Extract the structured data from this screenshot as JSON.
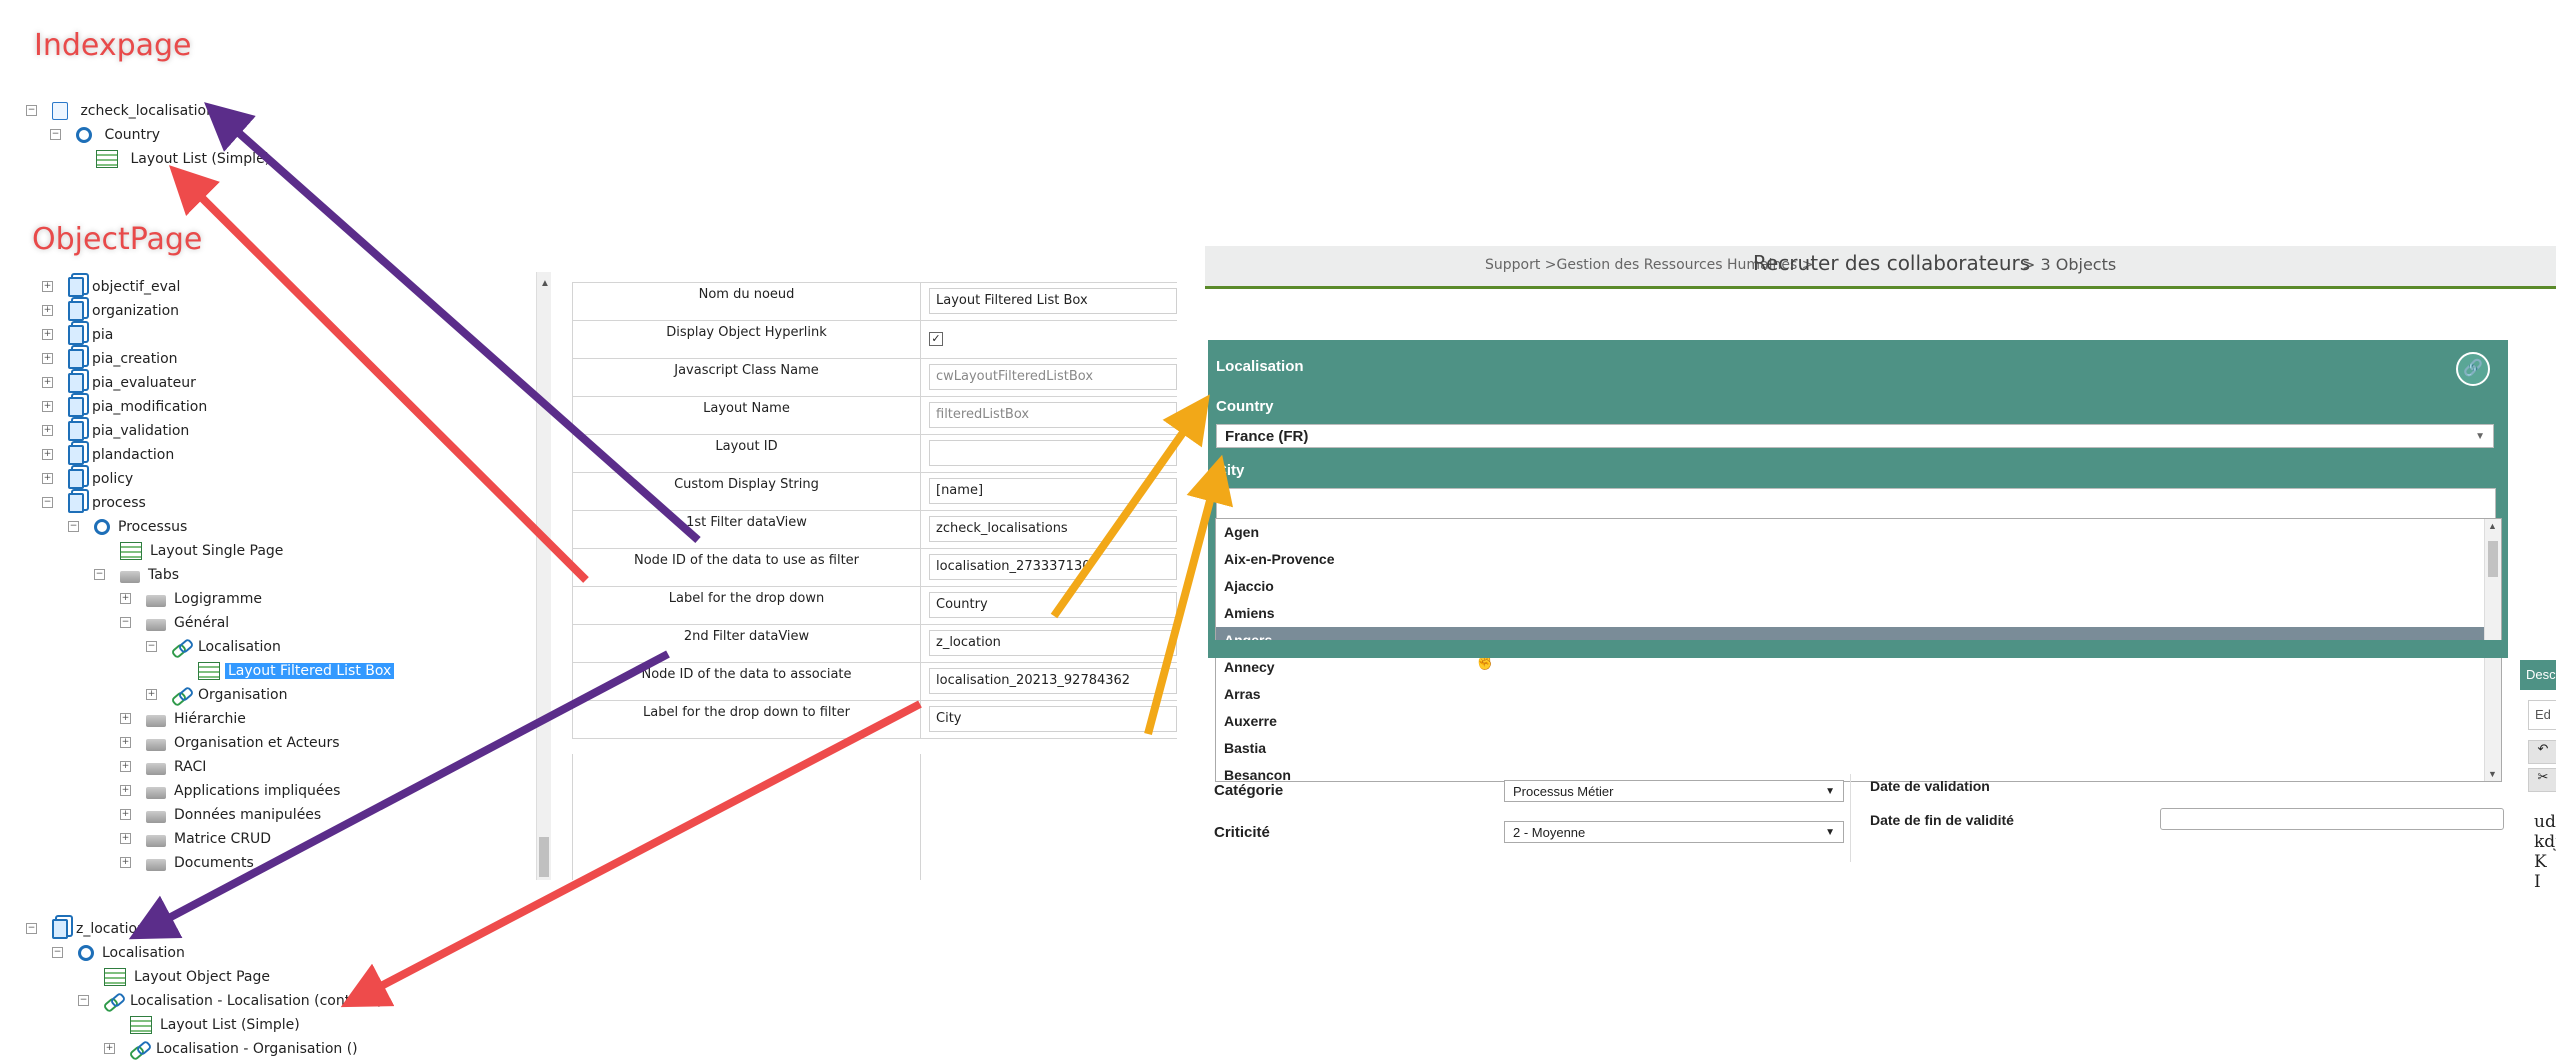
{
  "callouts": {
    "indexpage": "Indexpage",
    "objectpage": "ObjectPage"
  },
  "index_tree": [
    {
      "label": "zcheck_localisations"
    },
    {
      "label": "Country"
    },
    {
      "label": "Layout List (Simple)"
    }
  ],
  "object_tree": [
    "objectif_eval",
    "organization",
    "pia",
    "pia_creation",
    "pia_evaluateur",
    "pia_modification",
    "pia_validation",
    "plandaction",
    "policy",
    "process",
    "Processus",
    "Layout Single Page",
    "Tabs",
    "Logigramme",
    "Général",
    "Localisation",
    "Layout Filtered List Box",
    "Organisation",
    "Hiérarchie",
    "Organisation et Acteurs",
    "RACI",
    "Applications impliquées",
    "Données manipulées",
    "Matrice CRUD",
    "Documents"
  ],
  "location_tree": [
    "z_location",
    "Localisation",
    "Layout Object Page",
    "Localisation - Localisation (contient)",
    "Layout List (Simple)",
    "Localisation - Organisation ()"
  ],
  "properties": [
    {
      "key": "Nom du noeud",
      "value": "Layout Filtered List Box",
      "type": "text"
    },
    {
      "key": "Display Object Hyperlink",
      "value": "✓",
      "type": "checkbox"
    },
    {
      "key": "Javascript Class Name",
      "value": "cwLayoutFilteredListBox",
      "type": "readonly"
    },
    {
      "key": "Layout Name",
      "value": "filteredListBox",
      "type": "readonly"
    },
    {
      "key": "Layout ID",
      "value": "",
      "type": "text"
    },
    {
      "key": "Custom Display String",
      "value": "[name]",
      "type": "text"
    },
    {
      "key": "1st Filter dataView",
      "value": "zcheck_localisations",
      "type": "text"
    },
    {
      "key": "Node ID of the data to use as filter",
      "value": "localisation_273337130",
      "type": "text"
    },
    {
      "key": "Label for the drop down",
      "value": "Country",
      "type": "text"
    },
    {
      "key": "2nd Filter dataView",
      "value": "z_location",
      "type": "text"
    },
    {
      "key": "Node ID of the data to associate",
      "value": "localisation_20213_92784362",
      "type": "text"
    },
    {
      "key": "Label for the drop down to filter",
      "value": "City",
      "type": "text"
    }
  ],
  "breadcrumb": {
    "prefix": "Support >Gestion des Ressources Humaines >",
    "title": "Recruter des collaborateurs",
    "suffix": "> 3 Objects"
  },
  "panel": {
    "title": "Localisation",
    "country_label": "Country",
    "country_value": "France (FR)",
    "city_label": "City",
    "city_value": ""
  },
  "cities": [
    "Agen",
    "Aix-en-Provence",
    "Ajaccio",
    "Amiens",
    "Angers",
    "Annecy",
    "Arras",
    "Auxerre",
    "Bastia",
    "Besancon"
  ],
  "highlighted_city": "Angers",
  "form": {
    "categorie_label": "Catégorie",
    "categorie_value": "Processus Métier",
    "criticite_label": "Criticité",
    "criticite_value": "2 - Moyenne",
    "date_validation_label": "Date de validation",
    "date_fin_label": "Date de fin de validité",
    "side_header": "Desc",
    "side_edit": "Ed",
    "side_text_1": "udl",
    "side_text_2": "kdj",
    "side_text_3": "K I"
  },
  "colors": {
    "panel": "#4e9285",
    "arrow_purple": "#5b2d8a",
    "arrow_red": "#ee4b4b",
    "arrow_orange": "#f2a818",
    "selection": "#3399ff"
  }
}
